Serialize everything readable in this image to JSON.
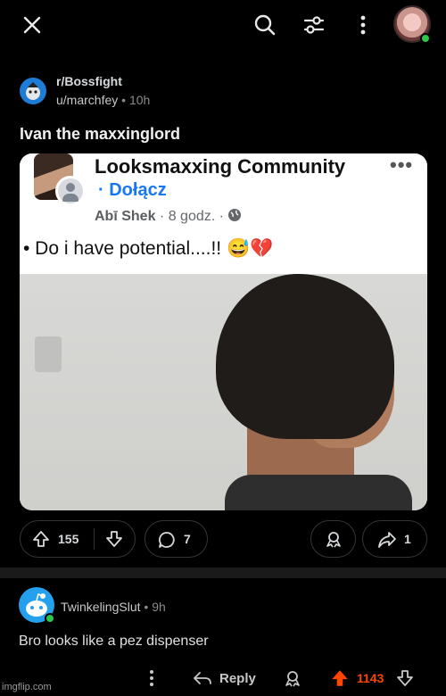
{
  "top_bar": {
    "icons": [
      "close-icon",
      "search-icon",
      "filter-icon",
      "more-vertical-icon"
    ],
    "online_color": "#2bc84a"
  },
  "post": {
    "subreddit": "r/Bossfight",
    "user": "u/marchfey",
    "separator": "•",
    "age": "10h",
    "title": "Ivan the maxxinglord",
    "image": {
      "group_name": "Looksmaxxing Community",
      "more": "•••",
      "join_prefix": "·",
      "join_label": "Dołącz",
      "author": "Abī Shek",
      "meta_sep": "·",
      "time": "8 godz.",
      "meta_end": "·",
      "text": "• Do i have potential....!! 😅💔"
    },
    "upvotes": "155",
    "comments": "7",
    "shares": "1"
  },
  "comment": {
    "user": "TwinkelingSlut",
    "separator": "•",
    "age": "9h",
    "text": "Bro looks like a pez dispenser",
    "reply_label": "Reply",
    "score": "1143",
    "score_color": "#ff4500"
  },
  "watermark": "imgflip.com"
}
